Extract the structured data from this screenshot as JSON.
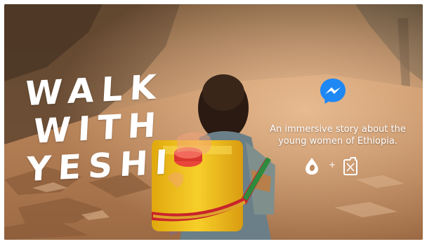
{
  "hero": {
    "title_lines": [
      "WALK",
      "WITH",
      "YESHI"
    ],
    "tagline": "An immersive story about the young women of Ethiopia.",
    "partners_separator": "+"
  },
  "icons": {
    "messenger": "messenger-icon",
    "partner_a": "water-drop-logo-icon",
    "partner_b": "jerrycan-icon"
  },
  "colors": {
    "messenger_blue": "#1e88f5",
    "jerrycan_yellow": "#f2c21a",
    "strap_red": "#c8242b",
    "strap_green": "#2e8b3d"
  }
}
